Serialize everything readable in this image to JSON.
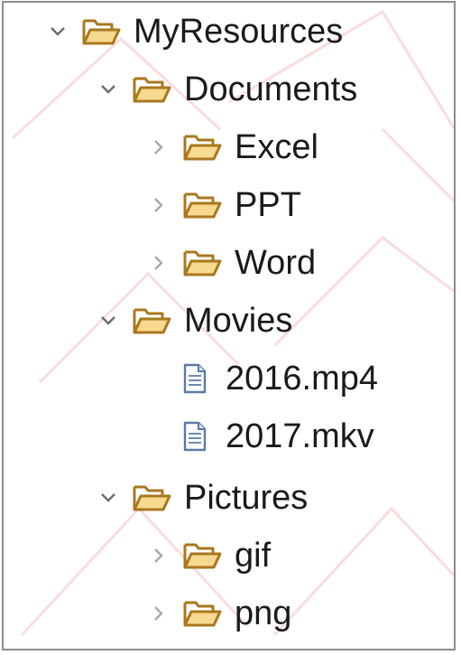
{
  "tree": {
    "root": {
      "label": "MyResources",
      "expanded": true,
      "icon": "folder-open-icon"
    },
    "documents": {
      "label": "Documents",
      "expanded": true,
      "icon": "folder-open-icon"
    },
    "excel": {
      "label": "Excel",
      "expanded": false,
      "icon": "folder-open-icon"
    },
    "ppt": {
      "label": "PPT",
      "expanded": false,
      "icon": "folder-open-icon"
    },
    "word": {
      "label": "Word",
      "expanded": false,
      "icon": "folder-open-icon"
    },
    "movies": {
      "label": "Movies",
      "expanded": true,
      "icon": "folder-open-icon"
    },
    "file_2016": {
      "label": "2016.mp4",
      "icon": "file-icon"
    },
    "file_2017": {
      "label": "2017.mkv",
      "icon": "file-icon"
    },
    "pictures": {
      "label": "Pictures",
      "expanded": true,
      "icon": "folder-open-icon"
    },
    "gif": {
      "label": "gif",
      "expanded": false,
      "icon": "folder-open-icon"
    },
    "png": {
      "label": "png",
      "expanded": false,
      "icon": "folder-open-icon"
    }
  },
  "colors": {
    "folder_fill": "#f7d98f",
    "folder_stroke": "#a8781e",
    "twisty": "#6b6b6b",
    "twisty_collapsed": "#a8a8a8",
    "file_stroke": "#5a7aa8",
    "watermark": "#e23b3b"
  }
}
